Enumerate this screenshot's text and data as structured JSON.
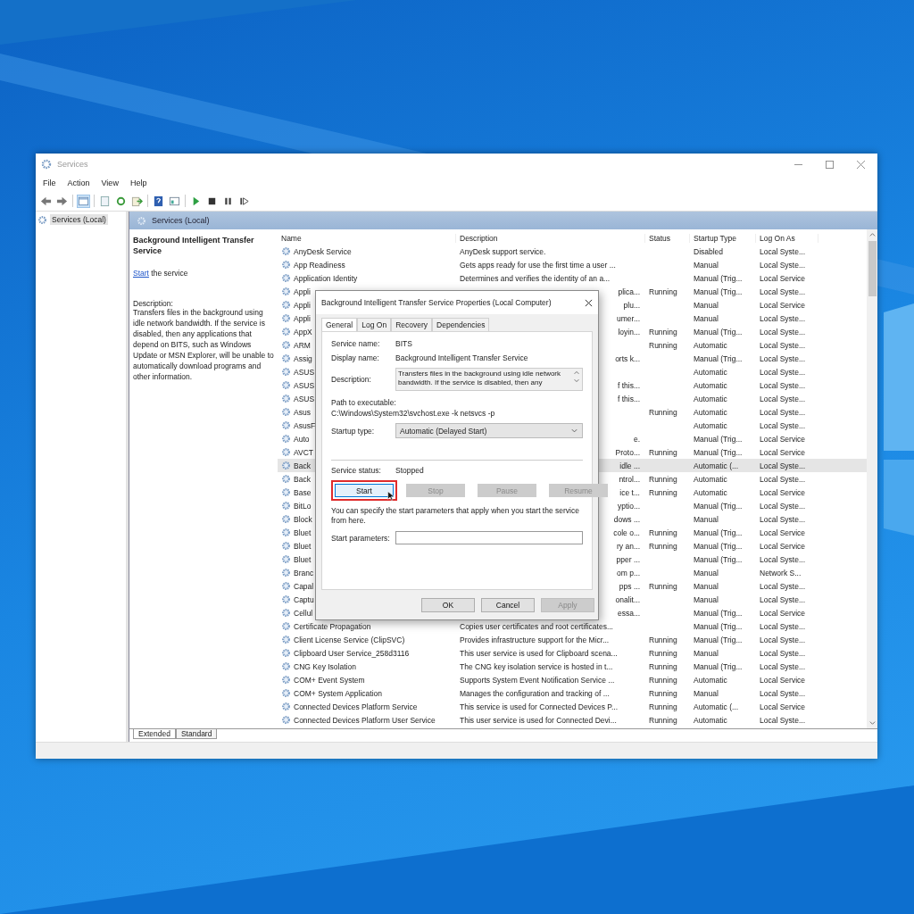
{
  "window": {
    "title": "Services"
  },
  "menu": [
    "File",
    "Action",
    "View",
    "Help"
  ],
  "tree": [
    {
      "label": "Services (Local)",
      "selected": true
    }
  ],
  "pane": {
    "header": "Services (Local)",
    "detail": {
      "title": "Background Intelligent Transfer Service",
      "action_link": "Start",
      "action_text": "the service",
      "description_label": "Description:",
      "description": "Transfers files in the background using idle network bandwidth. If the service is disabled, then any applications that depend on BITS, such as Windows Update or MSN Explorer, will be unable to automatically download programs and other information."
    }
  },
  "table": {
    "columns": [
      "Name",
      "Description",
      "Status",
      "Startup Type",
      "Log On As"
    ],
    "rows": [
      {
        "name": "AnyDesk Service",
        "description": "AnyDesk support service.",
        "startup": "Disabled",
        "logon": "Local Syste...",
        "covered": false,
        "selected": false
      },
      {
        "name": "App Readiness",
        "description": "Gets apps ready for use the first time a user ...",
        "startup": "Manual",
        "logon": "Local Syste...",
        "covered": false,
        "selected": false
      },
      {
        "name": "Application Identity",
        "description": "Determines and verifies the identity of an a...",
        "startup": "Manual (Trig...",
        "logon": "Local Service",
        "covered": false,
        "selected": false
      },
      {
        "name": "Appli",
        "description": "plica...",
        "status": "Running",
        "startup": "Manual (Trig...",
        "logon": "Local Syste...",
        "covered": true,
        "selected": false
      },
      {
        "name": "Appli",
        "description": "plu...",
        "startup": "Manual",
        "logon": "Local Service",
        "covered": true,
        "selected": false
      },
      {
        "name": "Appli",
        "description": "umer...",
        "startup": "Manual",
        "logon": "Local Syste...",
        "covered": true,
        "selected": false
      },
      {
        "name": "AppX",
        "description": "loyin...",
        "status": "Running",
        "startup": "Manual (Trig...",
        "logon": "Local Syste...",
        "covered": true,
        "selected": false
      },
      {
        "name": "ARM",
        "status": "Running",
        "startup": "Automatic",
        "logon": "Local Syste...",
        "selected": false
      },
      {
        "name": "Assig",
        "description": "orts k...",
        "startup": "Manual (Trig...",
        "logon": "Local Syste...",
        "covered": true,
        "selected": false
      },
      {
        "name": "ASUS",
        "startup": "Automatic",
        "logon": "Local Syste...",
        "selected": false
      },
      {
        "name": "ASUS",
        "description": "f this...",
        "startup": "Automatic",
        "logon": "Local Syste...",
        "covered": true,
        "selected": false
      },
      {
        "name": "ASUS",
        "description": "f this...",
        "startup": "Automatic",
        "logon": "Local Syste...",
        "covered": true,
        "selected": false
      },
      {
        "name": "Asus",
        "status": "Running",
        "startup": "Automatic",
        "logon": "Local Syste...",
        "selected": false
      },
      {
        "name": "AsusF",
        "startup": "Automatic",
        "logon": "Local Syste...",
        "selected": false
      },
      {
        "name": "Auto",
        "description": "e.",
        "startup": "Manual (Trig...",
        "logon": "Local Service",
        "covered": true,
        "selected": false
      },
      {
        "name": "AVCT",
        "description": "Proto...",
        "status": "Running",
        "startup": "Manual (Trig...",
        "logon": "Local Service",
        "covered": true,
        "selected": false
      },
      {
        "name": "Back",
        "description": "idle ...",
        "startup": "Automatic (...",
        "logon": "Local Syste...",
        "covered": true,
        "selected": true
      },
      {
        "name": "Back",
        "description": "ntrol...",
        "status": "Running",
        "startup": "Automatic",
        "logon": "Local Syste...",
        "covered": true,
        "selected": false
      },
      {
        "name": "Base",
        "description": "ice t...",
        "status": "Running",
        "startup": "Automatic",
        "logon": "Local Service",
        "covered": true,
        "selected": false
      },
      {
        "name": "BitLo",
        "description": "yptio...",
        "startup": "Manual (Trig...",
        "logon": "Local Syste...",
        "covered": true,
        "selected": false
      },
      {
        "name": "Block",
        "description": "dows ...",
        "startup": "Manual",
        "logon": "Local Syste...",
        "covered": true,
        "selected": false
      },
      {
        "name": "Bluet",
        "description": "cole o...",
        "status": "Running",
        "startup": "Manual (Trig...",
        "logon": "Local Service",
        "covered": true,
        "selected": false
      },
      {
        "name": "Bluet",
        "description": "ry an...",
        "status": "Running",
        "startup": "Manual (Trig...",
        "logon": "Local Service",
        "covered": true,
        "selected": false
      },
      {
        "name": "Bluet",
        "description": "pper ...",
        "startup": "Manual (Trig...",
        "logon": "Local Syste...",
        "covered": true,
        "selected": false
      },
      {
        "name": "Branc",
        "description": "om p...",
        "startup": "Manual",
        "logon": "Network S...",
        "covered": true,
        "selected": false
      },
      {
        "name": "Capal",
        "description": "pps ...",
        "status": "Running",
        "startup": "Manual",
        "logon": "Local Syste...",
        "covered": true,
        "selected": false
      },
      {
        "name": "Captu",
        "description": "onalit...",
        "startup": "Manual",
        "logon": "Local Syste...",
        "covered": true,
        "selected": false
      },
      {
        "name": "Cellul",
        "description": "essa...",
        "startup": "Manual (Trig...",
        "logon": "Local Service",
        "covered": true,
        "selected": false
      },
      {
        "name": "Certificate Propagation",
        "description": "Copies user certificates and root certificates...",
        "startup": "Manual (Trig...",
        "logon": "Local Syste...",
        "covered": false,
        "selected": false
      },
      {
        "name": "Client License Service (ClipSVC)",
        "description": "Provides infrastructure support for the Micr...",
        "status": "Running",
        "startup": "Manual (Trig...",
        "logon": "Local Syste...",
        "covered": false,
        "selected": false
      },
      {
        "name": "Clipboard User Service_258d3116",
        "description": "This user service is used for Clipboard scena...",
        "status": "Running",
        "startup": "Manual",
        "logon": "Local Syste...",
        "covered": false,
        "selected": false
      },
      {
        "name": "CNG Key Isolation",
        "description": "The CNG key isolation service is hosted in t...",
        "status": "Running",
        "startup": "Manual (Trig...",
        "logon": "Local Syste...",
        "covered": false,
        "selected": false
      },
      {
        "name": "COM+ Event System",
        "description": "Supports System Event Notification Service ...",
        "status": "Running",
        "startup": "Automatic",
        "logon": "Local Service",
        "covered": false,
        "selected": false
      },
      {
        "name": "COM+ System Application",
        "description": "Manages the configuration and tracking of ...",
        "status": "Running",
        "startup": "Manual",
        "logon": "Local Syste...",
        "covered": false,
        "selected": false
      },
      {
        "name": "Connected Devices Platform Service",
        "description": "This service is used for Connected Devices P...",
        "status": "Running",
        "startup": "Automatic (...",
        "logon": "Local Service",
        "covered": false,
        "selected": false
      },
      {
        "name": "Connected Devices Platform User Service",
        "description": "This user service is used for Connected Devi...",
        "status": "Running",
        "startup": "Automatic",
        "logon": "Local Syste...",
        "covered": false,
        "selected": false
      }
    ]
  },
  "bottom_tabs": [
    {
      "label": "Extended",
      "selected": true
    },
    {
      "label": "Standard",
      "selected": false
    }
  ],
  "dialog": {
    "title": "Background Intelligent Transfer Service Properties (Local Computer)",
    "tabs": [
      {
        "label": "General",
        "selected": true
      },
      {
        "label": "Log On",
        "selected": false
      },
      {
        "label": "Recovery",
        "selected": false
      },
      {
        "label": "Dependencies",
        "selected": false
      }
    ],
    "service_name_label": "Service name:",
    "service_name": "BITS",
    "display_name_label": "Display name:",
    "display_name": "Background Intelligent Transfer Service",
    "description_label": "Description:",
    "description": "Transfers files in the background using idle network bandwidth. If the service is disabled, then any",
    "path_label": "Path to executable:",
    "path": "C:\\Windows\\System32\\svchost.exe -k netsvcs -p",
    "startup_type_label": "Startup type:",
    "startup_type": "Automatic (Delayed Start)",
    "service_status_label": "Service status:",
    "service_status": "Stopped",
    "control_buttons": [
      {
        "label": "Start",
        "disabled": false,
        "highlighted": true
      },
      {
        "label": "Stop",
        "disabled": true,
        "highlighted": false
      },
      {
        "label": "Pause",
        "disabled": true,
        "highlighted": false
      },
      {
        "label": "Resume",
        "disabled": true,
        "highlighted": false
      }
    ],
    "hint": "You can specify the start parameters that apply when you start the service from here.",
    "start_parameters_label": "Start parameters:",
    "buttons": [
      {
        "label": "OK",
        "disabled": false
      },
      {
        "label": "Cancel",
        "disabled": false
      },
      {
        "label": "Apply",
        "disabled": true
      }
    ]
  }
}
